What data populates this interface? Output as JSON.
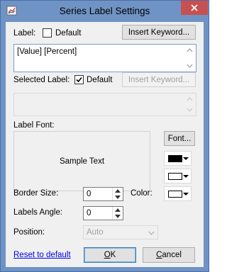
{
  "window": {
    "title": "Series Label Settings"
  },
  "label": {
    "caption": "Label:",
    "default_label": "Default",
    "default_checked": false,
    "insert_keyword": "Insert Keyword...",
    "text": "[Value] [Percent]"
  },
  "selected_label": {
    "caption": "Selected Label:",
    "default_label": "Default",
    "default_checked": true,
    "insert_keyword": "Insert Keyword...",
    "text": ""
  },
  "font": {
    "caption": "Label Font:",
    "font_button": "Font...",
    "sample_text": "Sample Text",
    "text_color": "#000000",
    "back_color": "#ffffff"
  },
  "border": {
    "size_label": "Border Size:",
    "size_value": "0",
    "color_label": "Color:",
    "color_value": "#ffffff"
  },
  "angle": {
    "label": "Labels Angle:",
    "value": "0"
  },
  "position": {
    "label": "Position:",
    "value": "Auto"
  },
  "footer": {
    "reset": "Reset to default",
    "ok": "OK",
    "cancel": "Cancel"
  }
}
